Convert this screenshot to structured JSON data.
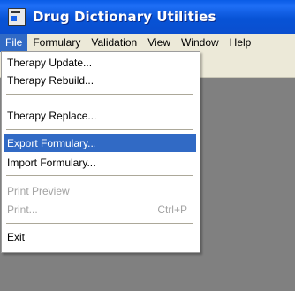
{
  "window": {
    "title": "Drug Dictionary Utilities",
    "icon": "app-document-icon"
  },
  "menubar": {
    "items": [
      {
        "label": "File",
        "active": true
      },
      {
        "label": "Formulary"
      },
      {
        "label": "Validation"
      },
      {
        "label": "View"
      },
      {
        "label": "Window"
      },
      {
        "label": "Help"
      }
    ]
  },
  "file_menu": {
    "items": [
      {
        "label": "Therapy Update...",
        "enabled": true
      },
      {
        "label": "Therapy Rebuild...",
        "enabled": true
      },
      {
        "label": "Therapy Replace...",
        "enabled": true
      },
      {
        "label": "Export Formulary...",
        "enabled": true,
        "highlighted": true
      },
      {
        "label": "Import Formulary...",
        "enabled": true
      },
      {
        "label": "Print Preview",
        "enabled": false
      },
      {
        "label": "Print...",
        "enabled": false,
        "shortcut": "Ctrl+P"
      },
      {
        "label": "Exit",
        "enabled": true
      }
    ]
  },
  "colors": {
    "titlebar": "#0a5ce6",
    "menu_highlight": "#316ac5",
    "client_background": "#808080",
    "chrome": "#ece9d8",
    "disabled_text": "#a3a3a3"
  }
}
